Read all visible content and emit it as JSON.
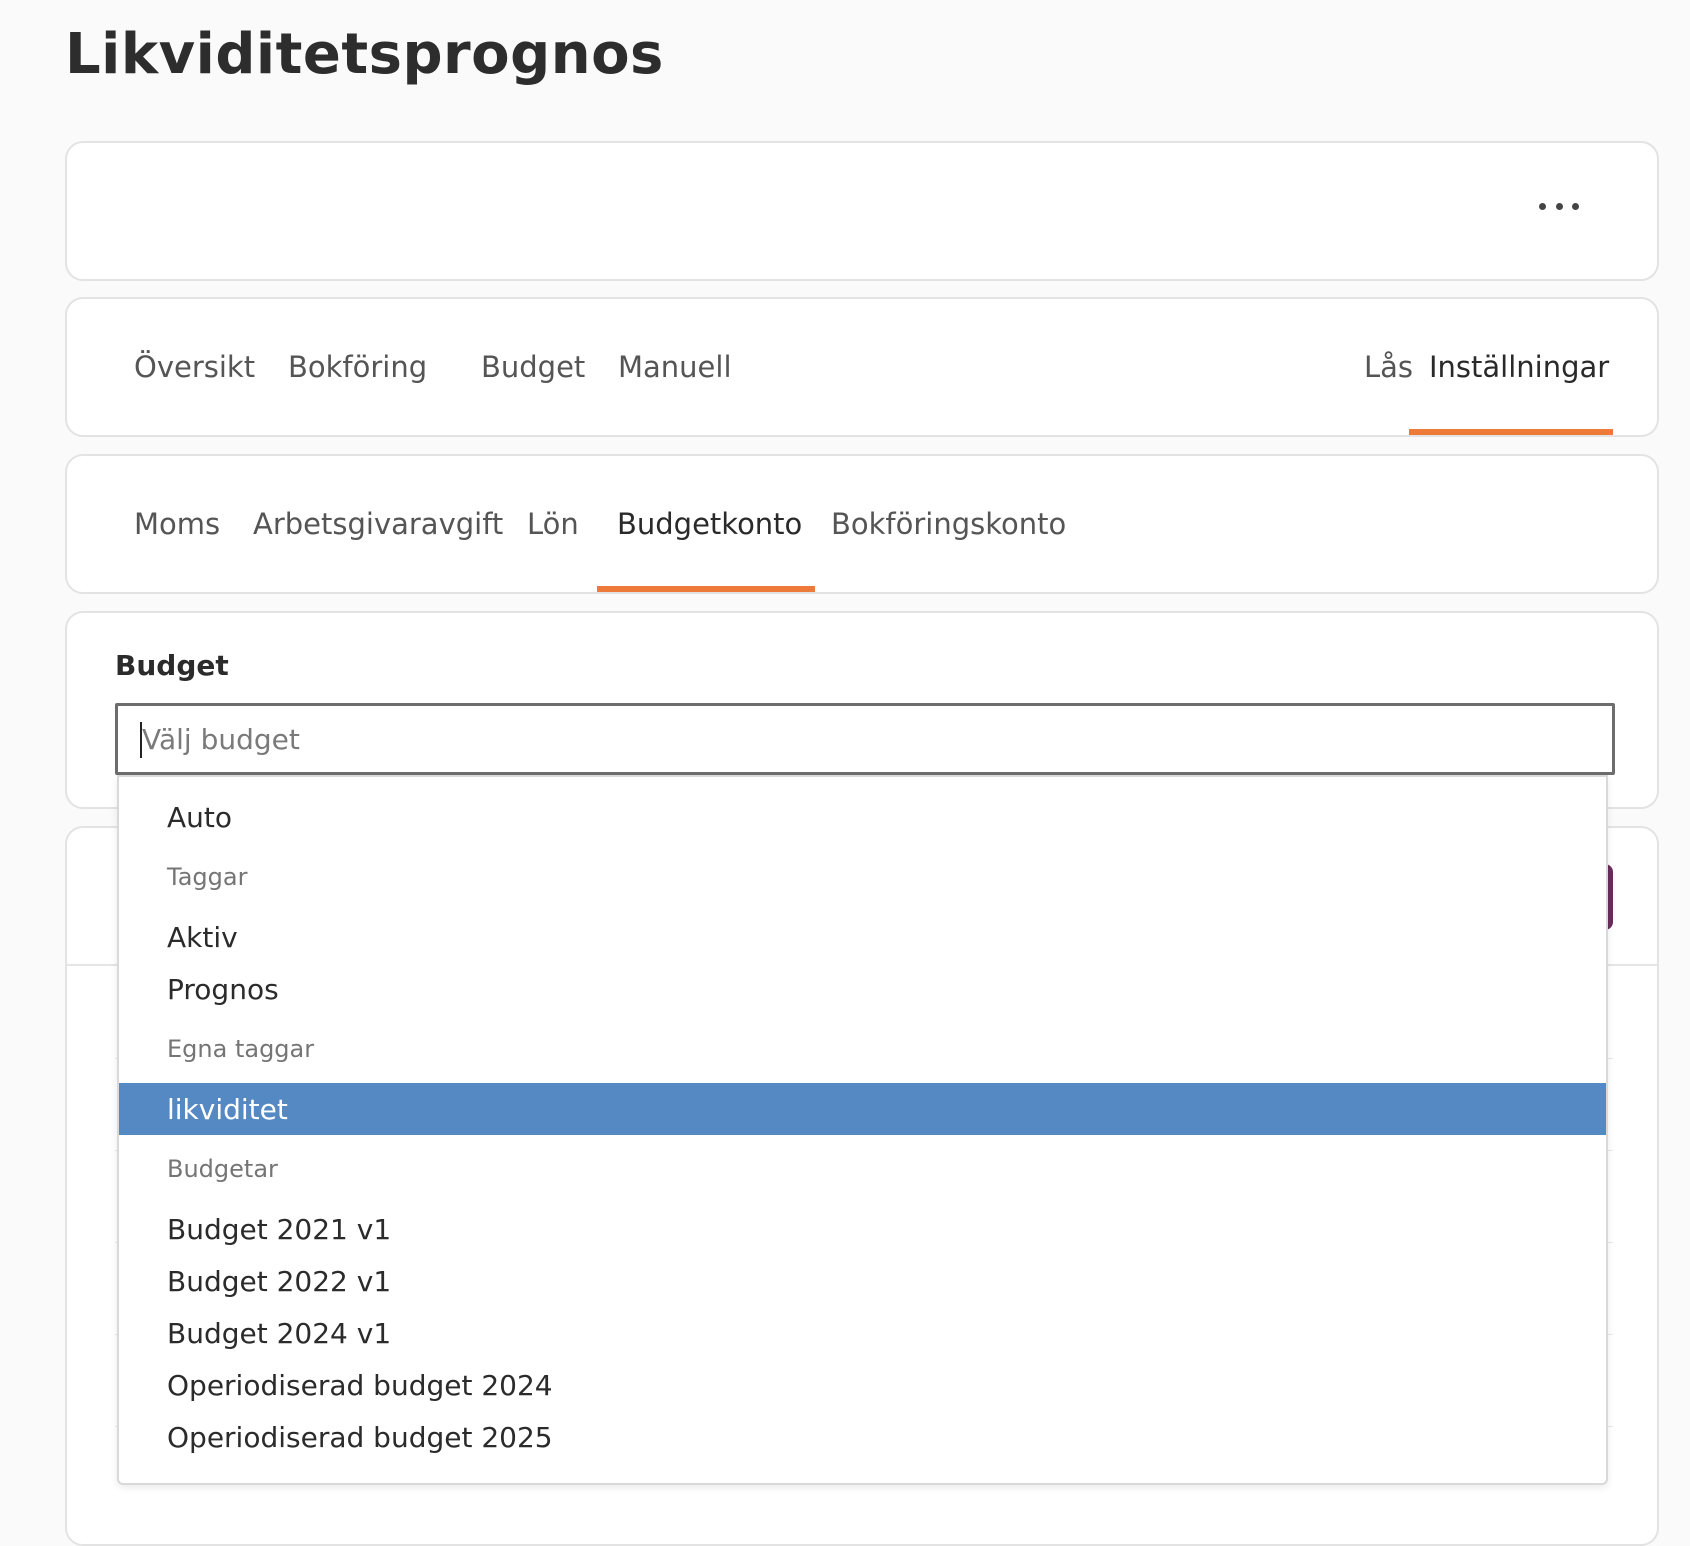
{
  "page": {
    "title": "Likviditetsprognos"
  },
  "main_tabs": [
    {
      "label": "Översikt"
    },
    {
      "label": "Bokföring"
    },
    {
      "label": "Budget"
    },
    {
      "label": "Manuell"
    },
    {
      "label": "Lås"
    },
    {
      "label": "Inställningar",
      "active": true
    }
  ],
  "settings_tabs": [
    {
      "label": "Moms"
    },
    {
      "label": "Arbetsgivaravgift"
    },
    {
      "label": "Lön"
    },
    {
      "label": "Budgetkonto",
      "active": true
    },
    {
      "label": "Bokföringskonto"
    }
  ],
  "budget_field": {
    "label": "Budget",
    "placeholder": "Välj budget",
    "value": ""
  },
  "dropdown": {
    "auto_option": "Auto",
    "group_tags": "Taggar",
    "tag_options": [
      "Aktiv",
      "Prognos"
    ],
    "group_custom_tags": "Egna taggar",
    "custom_tag_options": [
      "likviditet"
    ],
    "highlighted_option": "likviditet",
    "group_budgets": "Budgetar",
    "budget_options": [
      "Budget 2021 v1",
      "Budget 2022 v1",
      "Budget 2024 v1",
      "Operiodiserad budget 2024",
      "Operiodiserad budget 2025"
    ]
  },
  "colors": {
    "accent_underline": "#ee7a3a",
    "highlight": "#5589c4",
    "purple_button": "#6a2c5c"
  }
}
